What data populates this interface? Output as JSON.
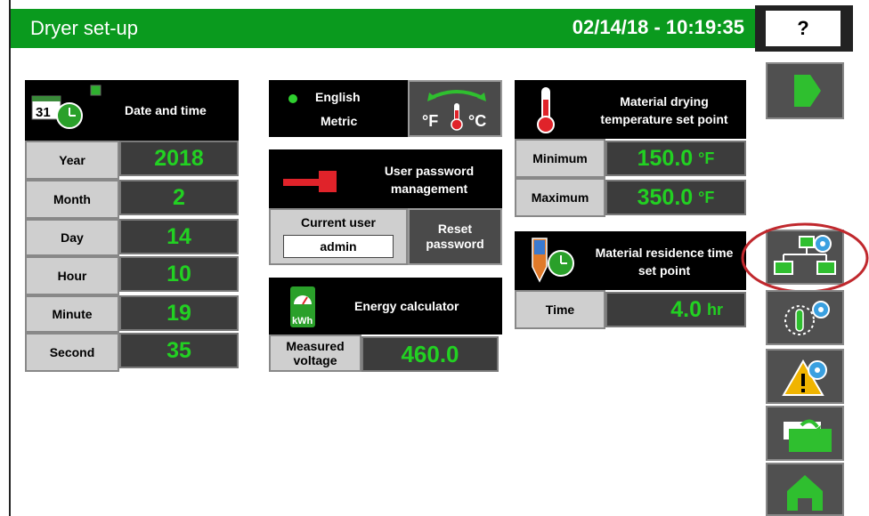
{
  "header": {
    "title": "Dryer set-up",
    "datetime": "02/14/18 - 10:19:35",
    "help_label": "?"
  },
  "date_time_panel": {
    "title": "Date and time",
    "calendar_day": "31",
    "rows": [
      {
        "label": "Year",
        "value": "2018"
      },
      {
        "label": "Month",
        "value": "2"
      },
      {
        "label": "Day",
        "value": "14"
      },
      {
        "label": "Hour",
        "value": "10"
      },
      {
        "label": "Minute",
        "value": "19"
      },
      {
        "label": "Second",
        "value": "35"
      }
    ]
  },
  "units_panel": {
    "language": "English",
    "units": "Metric",
    "toggle_f": "°F",
    "toggle_c": "°C"
  },
  "password_panel": {
    "title": "User password management",
    "current_user_label": "Current user",
    "current_user_value": "admin",
    "reset_button": "Reset password"
  },
  "energy_panel": {
    "title": "Energy calculator",
    "icon_text": "kWh",
    "voltage_label": "Measured voltage",
    "voltage_value": "460.0"
  },
  "drying_temp_panel": {
    "title": "Material drying temperature set point",
    "min_label": "Minimum",
    "min_value": "150.0",
    "max_label": "Maximum",
    "max_value": "350.0",
    "unit": "°F"
  },
  "residence_panel": {
    "title": "Material residence time set point",
    "time_label": "Time",
    "time_value": "4.0",
    "unit": "hr"
  },
  "sidebar": {
    "buttons": [
      "next-arrow",
      "network-settings",
      "timer-settings",
      "alarm-settings",
      "folder-transfer",
      "home"
    ]
  },
  "colors": {
    "header_green": "#0a9a1e",
    "value_green": "#22d122",
    "panel_black": "#000000",
    "highlight_ring": "#c0282d"
  }
}
